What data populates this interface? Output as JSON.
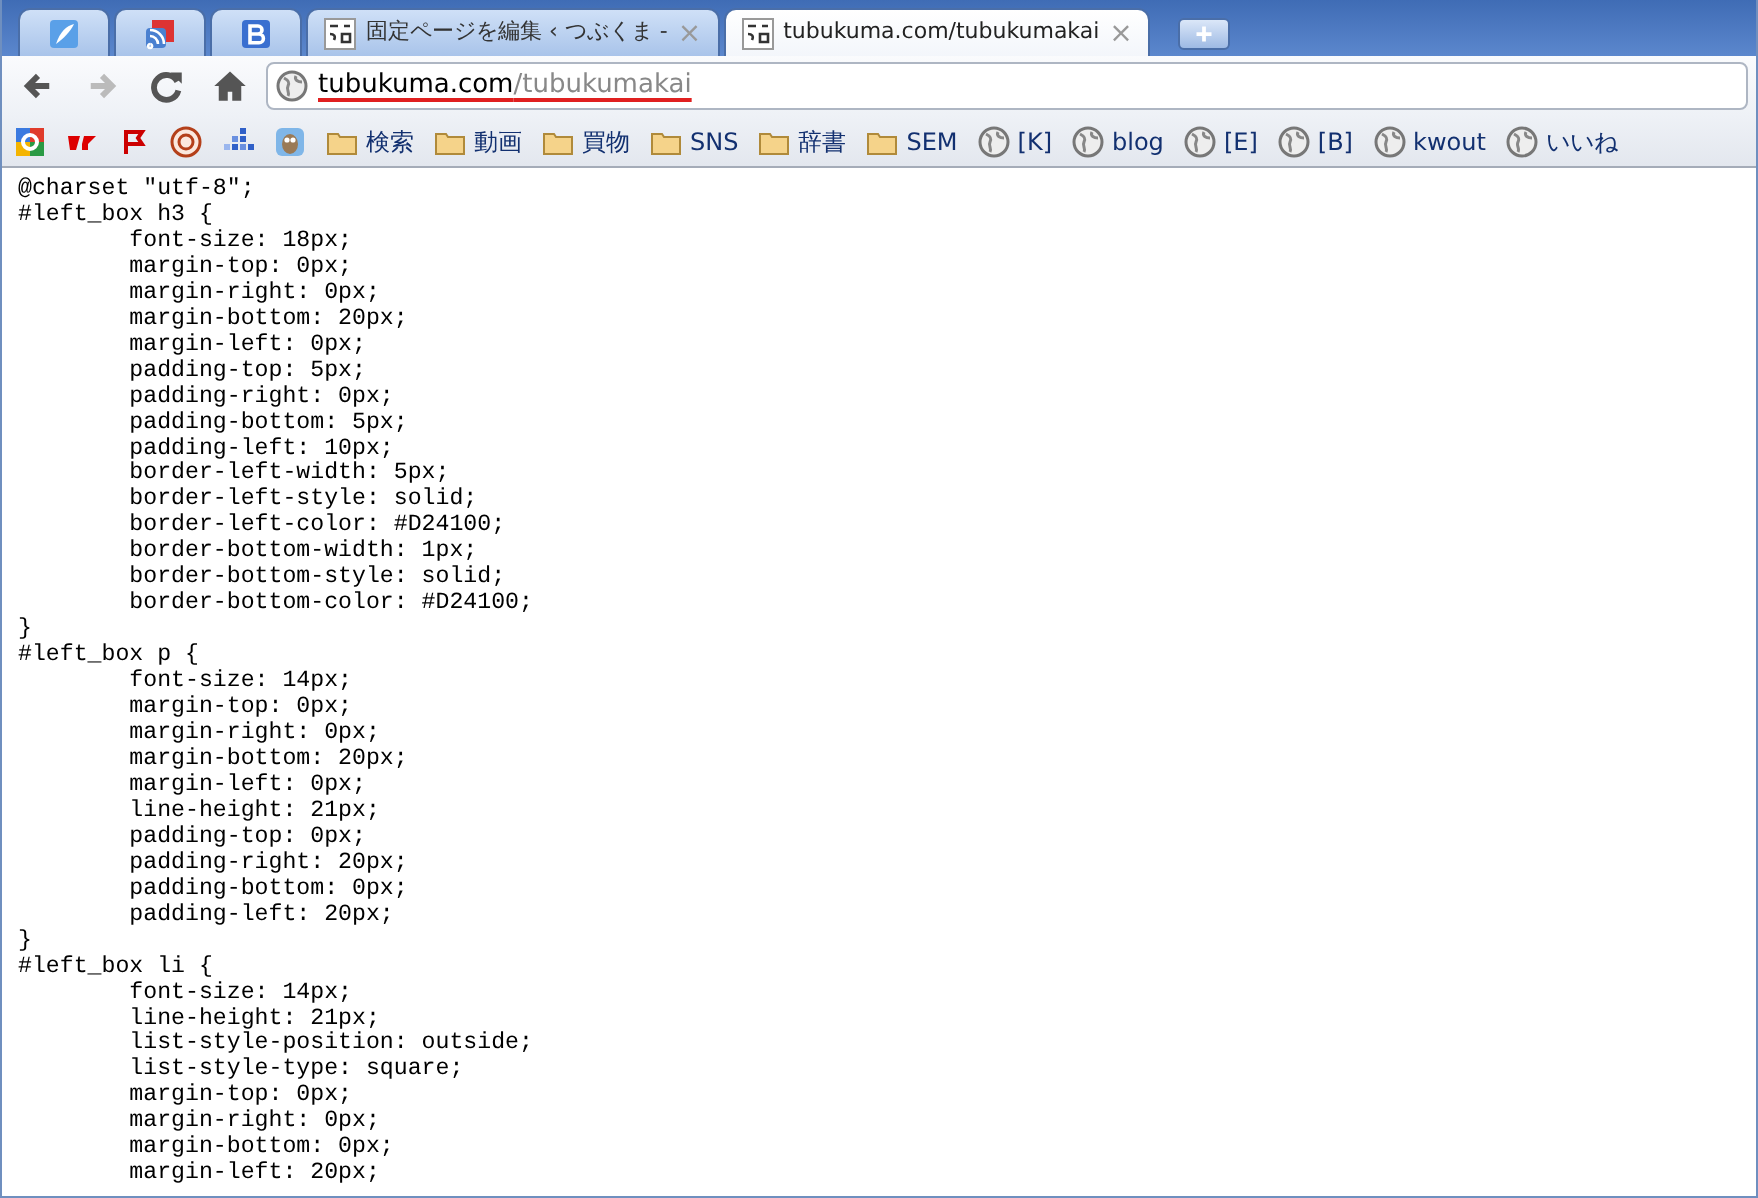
{
  "tabs": [
    {
      "kind": "icon",
      "selected": false
    },
    {
      "kind": "icon",
      "selected": false
    },
    {
      "kind": "icon",
      "selected": false
    },
    {
      "kind": "titled",
      "title": "固定ページを編集 ‹ つぶくま -",
      "close": "×",
      "selected": false
    },
    {
      "kind": "titled",
      "title": "tubukuma.com/tubukumakai",
      "close": "×",
      "selected": true
    }
  ],
  "toolbar": {
    "back_enabled": true,
    "forward_enabled": false,
    "url_host": "tubukuma.com",
    "url_path": "/tubukumakai"
  },
  "bookmarks": [
    {
      "kind": "icon"
    },
    {
      "kind": "icon"
    },
    {
      "kind": "icon"
    },
    {
      "kind": "icon"
    },
    {
      "kind": "icon"
    },
    {
      "kind": "icon"
    },
    {
      "kind": "folder",
      "label": "検索"
    },
    {
      "kind": "folder",
      "label": "動画"
    },
    {
      "kind": "folder",
      "label": "買物"
    },
    {
      "kind": "folder",
      "label": "SNS"
    },
    {
      "kind": "folder",
      "label": "辞書"
    },
    {
      "kind": "folder",
      "label": "SEM"
    },
    {
      "kind": "page",
      "label": "[K]"
    },
    {
      "kind": "page",
      "label": "blog"
    },
    {
      "kind": "page",
      "label": "[E]"
    },
    {
      "kind": "page",
      "label": "[B]"
    },
    {
      "kind": "page",
      "label": "kwout"
    },
    {
      "kind": "page",
      "label": "いいね"
    }
  ],
  "code_lines": [
    "@charset \"utf-8\";",
    "#left_box h3 {",
    "\tfont-size: 18px;",
    "\tmargin-top: 0px;",
    "\tmargin-right: 0px;",
    "\tmargin-bottom: 20px;",
    "\tmargin-left: 0px;",
    "\tpadding-top: 5px;",
    "\tpadding-right: 0px;",
    "\tpadding-bottom: 5px;",
    "\tpadding-left: 10px;",
    "\tborder-left-width: 5px;",
    "\tborder-left-style: solid;",
    "\tborder-left-color: #D24100;",
    "\tborder-bottom-width: 1px;",
    "\tborder-bottom-style: solid;",
    "\tborder-bottom-color: #D24100;",
    "}",
    "#left_box p {",
    "\tfont-size: 14px;",
    "\tmargin-top: 0px;",
    "\tmargin-right: 0px;",
    "\tmargin-bottom: 20px;",
    "\tmargin-left: 0px;",
    "\tline-height: 21px;",
    "\tpadding-top: 0px;",
    "\tpadding-right: 20px;",
    "\tpadding-bottom: 0px;",
    "\tpadding-left: 20px;",
    "}",
    "#left_box li {",
    "\tfont-size: 14px;",
    "\tline-height: 21px;",
    "\tlist-style-position: outside;",
    "\tlist-style-type: square;",
    "\tmargin-top: 0px;",
    "\tmargin-right: 0px;",
    "\tmargin-bottom: 0px;",
    "\tmargin-left: 20px;"
  ]
}
